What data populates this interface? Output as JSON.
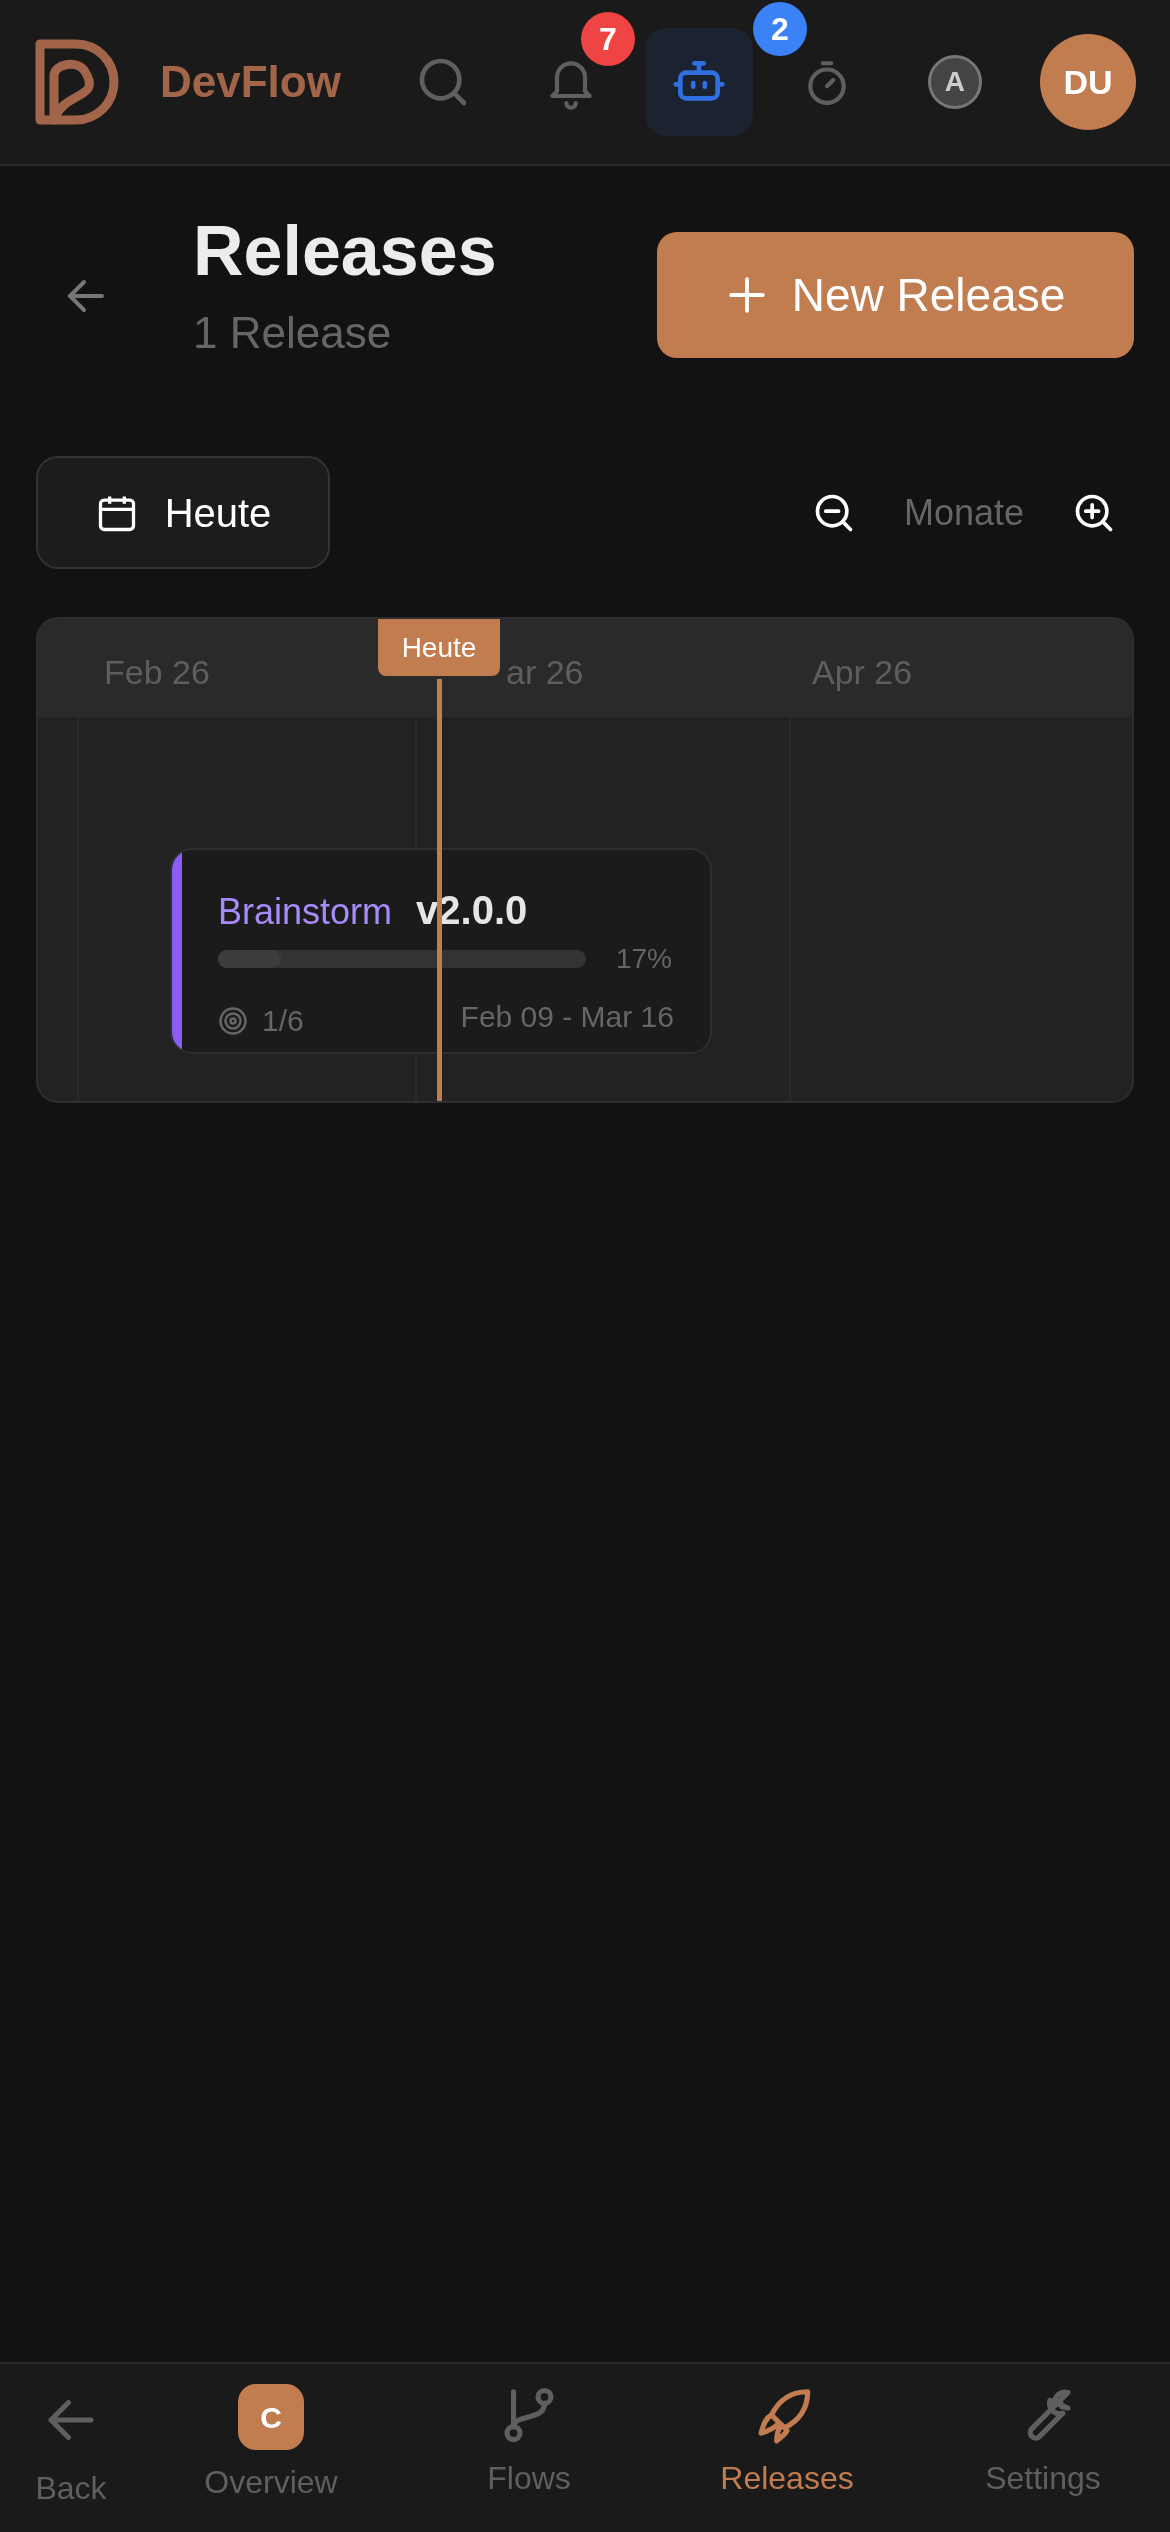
{
  "app": {
    "name": "DevFlow"
  },
  "header_actions": [
    {
      "kind": "search",
      "selected": false
    },
    {
      "kind": "bell",
      "badge": "7",
      "selected": false
    },
    {
      "kind": "bot",
      "badge": "2",
      "selected": true
    },
    {
      "kind": "timer",
      "selected": false
    },
    {
      "kind": "letter",
      "text": "A",
      "selected": false
    }
  ],
  "avatar": "DU",
  "page": {
    "title": "Releases",
    "subtitle": "1 Release",
    "new_button": "New Release"
  },
  "toolbar": {
    "today_button": "Heute",
    "zoom_level": "Monate"
  },
  "timeline": {
    "months": [
      "Feb 26",
      "ar 26",
      "Apr 26"
    ],
    "today_label": "Heute",
    "releases": [
      {
        "name": "Brainstorm",
        "version": "v2.0.0",
        "color": "#8b5cf6",
        "progress": "17%",
        "level": 0.17,
        "tasks": "1/6",
        "dates": "Feb 09 - Mar 16"
      }
    ]
  },
  "bottom_nav": [
    {
      "kind": "back",
      "label": "Back",
      "selected": false
    },
    {
      "kind": "letter",
      "letter": "C",
      "label": "Overview",
      "selected": false
    },
    {
      "kind": "flows",
      "label": "Flows",
      "selected": false
    },
    {
      "kind": "releases",
      "label": "Releases",
      "selected": true
    },
    {
      "kind": "settings",
      "label": "Settings",
      "selected": false
    }
  ]
}
